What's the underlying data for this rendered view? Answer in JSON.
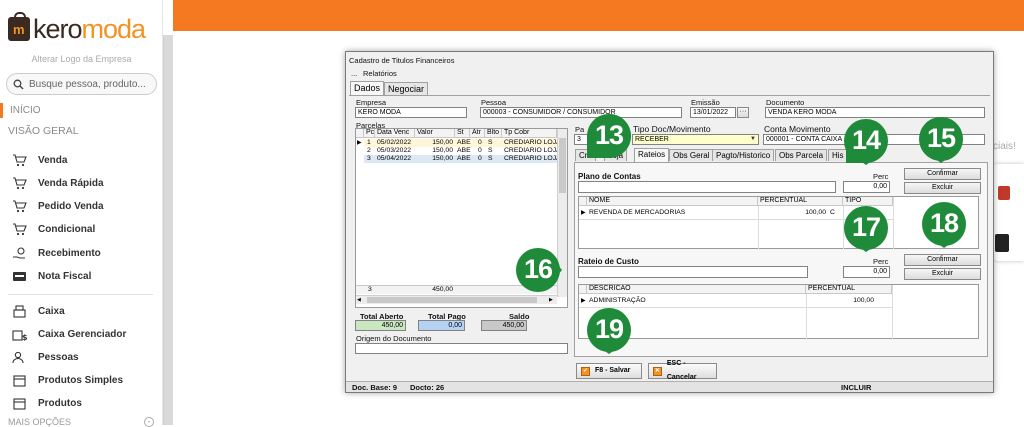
{
  "colors": {
    "brand_orange": "#f47920",
    "logo_dark": "#3a2a22",
    "badge_green": "#1e8a3a"
  },
  "sidebar": {
    "logo_part1": "kero",
    "logo_part2": "moda",
    "change_logo": "Alterar Logo da Empresa",
    "search_placeholder": "Busque pessoa, produto...",
    "inicio": "INÍCIO",
    "section_visao": "VISÃO GERAL",
    "items": [
      {
        "label": "Venda",
        "icon": "cart-icon"
      },
      {
        "label": "Venda Rápida",
        "icon": "cart-fast-icon"
      },
      {
        "label": "Pedido Venda",
        "icon": "cart-order-icon"
      },
      {
        "label": "Condicional",
        "icon": "cart-conditional-icon"
      },
      {
        "label": "Recebimento",
        "icon": "money-hand-icon"
      },
      {
        "label": "Nota Fiscal",
        "icon": "nfe-icon"
      },
      {
        "label": "Caixa",
        "icon": "cash-register-icon"
      },
      {
        "label": "Caixa Gerenciador",
        "icon": "cash-manager-icon"
      },
      {
        "label": "Pessoas",
        "icon": "people-icon"
      },
      {
        "label": "Produtos Simples",
        "icon": "box-icon"
      },
      {
        "label": "Produtos",
        "icon": "boxes-icon"
      }
    ],
    "more": "MAIS OPÇÕES"
  },
  "background": {
    "partial_text": "ciais!"
  },
  "dialog": {
    "title": "Cadastro de Titulos Financeiros",
    "menu": [
      "...",
      "Relatórios"
    ],
    "main_tabs": [
      "Dados",
      "Negociar"
    ],
    "empresa": {
      "label": "Empresa",
      "value": "KERO MODA"
    },
    "pessoa": {
      "label": "Pessoa",
      "value": "000003 - CONSUMIDOR / CONSUMIDOR"
    },
    "emissao": {
      "label": "Emissão",
      "value": "13/01/2022"
    },
    "documento": {
      "label": "Documento",
      "value": "VENDA KERO MODA"
    },
    "parcelas": {
      "label": "Parcelas",
      "columns": [
        "Pc",
        "Data Venc",
        "Valor",
        "St",
        "Atr",
        "Blto",
        "Tp Cobr"
      ],
      "rows": [
        [
          "1",
          "05/02/2022",
          "150,00",
          "ABE",
          "0",
          "S",
          "CREDIARIO LOJA"
        ],
        [
          "2",
          "05/03/2022",
          "150,00",
          "ABE",
          "0",
          "S",
          "CREDIARIO LOJA"
        ],
        [
          "3",
          "05/04/2022",
          "150,00",
          "ABE",
          "0",
          "S",
          "CREDIARIO LOJA"
        ]
      ],
      "footer_count": "3",
      "footer_total": "450,00"
    },
    "totais": {
      "aberto_label": "Total Aberto",
      "aberto_value": "450,00",
      "pago_label": "Total Pago",
      "pago_value": "0,00",
      "saldo_label": "Saldo",
      "saldo_value": "450,00"
    },
    "origem": {
      "label": "Origem do Documento",
      "value": ""
    },
    "pa_label": "Pa",
    "pa_value": "3",
    "tipo_doc": {
      "label": "Tipo Doc/Movimento",
      "value": "RECEBER"
    },
    "conta": {
      "label": "Conta Movimento",
      "value": "000001 - CONTA CAIXA"
    },
    "sub_tabs": [
      "Cre",
      "Loja",
      "Rateios",
      "Obs Geral",
      "Pagto/Historico",
      "Obs Parcela",
      "His"
    ],
    "plano": {
      "label": "Plano de Contas",
      "perc_label": "Perc",
      "perc_value": "0,00",
      "confirm": "Confirmar",
      "delete": "Excluir",
      "columns": [
        "NOME",
        "PERCENTUAL",
        "TIPO"
      ],
      "rows": [
        [
          "REVENDA DE MERCADORIAS",
          "100,00",
          "C"
        ]
      ]
    },
    "rateio": {
      "label": "Rateio de Custo",
      "perc_label": "Perc",
      "perc_value": "0,00",
      "confirm": "Confirmar",
      "delete": "Excluir",
      "columns": [
        "DESCRICAO",
        "PERCENTUAL"
      ],
      "rows": [
        [
          "ADMINISTRAÇÃO",
          "100,00"
        ]
      ]
    },
    "buttons": {
      "save": "F8 - Salvar",
      "cancel": "ESC - Cancelar"
    },
    "status": {
      "doc_base": "Doc. Base: 9",
      "docto": "Docto: 26",
      "mode": "INCLUIR"
    }
  },
  "badges": [
    "13",
    "14",
    "15",
    "16",
    "17",
    "18",
    "19"
  ]
}
